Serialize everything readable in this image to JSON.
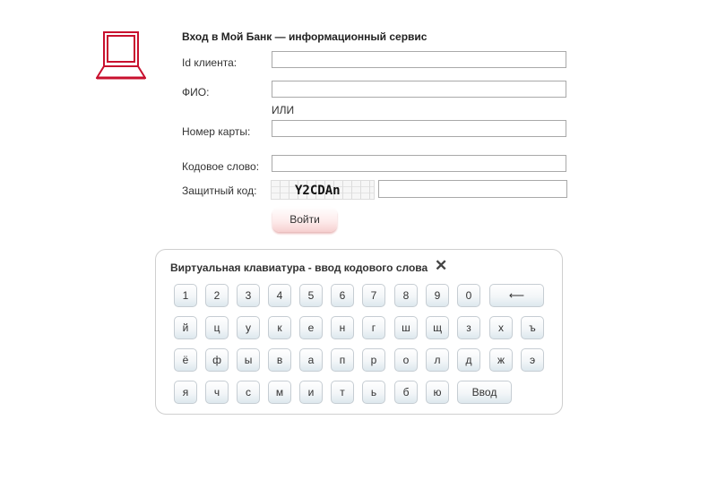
{
  "form": {
    "title": "Вход в Мой Банк — информационный сервис",
    "client_id_label": "Id клиента:",
    "fio_label": "ФИО:",
    "or_text": "ИЛИ",
    "card_label": "Номер карты:",
    "codeword_label": "Кодовое слово:",
    "security_label": "Защитный код:",
    "captcha_text": "Y2CDAn",
    "login_label": "Войти"
  },
  "keyboard": {
    "title": "Виртуальная клавиатура - ввод кодового слова",
    "close_symbol": "✕",
    "row1": [
      "1",
      "2",
      "3",
      "4",
      "5",
      "6",
      "7",
      "8",
      "9",
      "0"
    ],
    "backspace": "⟵",
    "row2": [
      "й",
      "ц",
      "у",
      "к",
      "е",
      "н",
      "г",
      "ш",
      "щ",
      "з",
      "х",
      "ъ"
    ],
    "row3": [
      "ё",
      "ф",
      "ы",
      "в",
      "а",
      "п",
      "р",
      "о",
      "л",
      "д",
      "ж",
      "э"
    ],
    "row4": [
      "я",
      "ч",
      "с",
      "м",
      "и",
      "т",
      "ь",
      "б",
      "ю"
    ],
    "enter": "Ввод"
  },
  "colors": {
    "accent": "#c8102e",
    "button_pink": "#f6cfcf"
  },
  "icons": {
    "laptop": "laptop-icon",
    "close": "close-icon"
  }
}
